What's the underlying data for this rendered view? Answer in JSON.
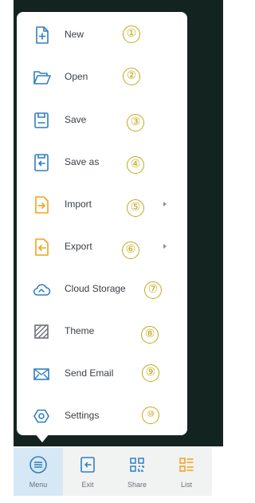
{
  "colors": {
    "backdrop": "#132320",
    "panel": "#ffffff",
    "icon_blue": "#2f7fc1",
    "icon_orange": "#f0a31a",
    "icon_grey": "#6c7278",
    "annotation_gold": "#c2a91c",
    "active_tab_bg": "#d6e8f5",
    "toolbar_bg": "#f1f2f2"
  },
  "menu": {
    "items": [
      {
        "label": "New",
        "icon": "new-file-icon",
        "annotation": "①"
      },
      {
        "label": "Open",
        "icon": "open-folder-icon",
        "annotation": "②"
      },
      {
        "label": "Save",
        "icon": "save-icon",
        "annotation": "③"
      },
      {
        "label": "Save as",
        "icon": "save-as-icon",
        "annotation": "④"
      },
      {
        "label": "Import",
        "icon": "import-icon",
        "annotation": "⑤",
        "has_submenu": true
      },
      {
        "label": "Export",
        "icon": "export-icon",
        "annotation": "⑥",
        "has_submenu": true
      },
      {
        "label": "Cloud Storage",
        "icon": "cloud-storage-icon",
        "annotation": "⑦"
      },
      {
        "label": "Theme",
        "icon": "theme-icon",
        "annotation": "⑧"
      },
      {
        "label": "Send Email",
        "icon": "email-icon",
        "annotation": "⑨"
      },
      {
        "label": "Settings",
        "icon": "settings-icon",
        "annotation": "⑩"
      }
    ]
  },
  "toolbar": {
    "active": "Menu",
    "items": [
      {
        "label": "Menu",
        "icon": "menu-icon"
      },
      {
        "label": "Exit",
        "icon": "exit-icon"
      },
      {
        "label": "Share",
        "icon": "share-qr-icon"
      },
      {
        "label": "List",
        "icon": "list-icon"
      }
    ]
  }
}
